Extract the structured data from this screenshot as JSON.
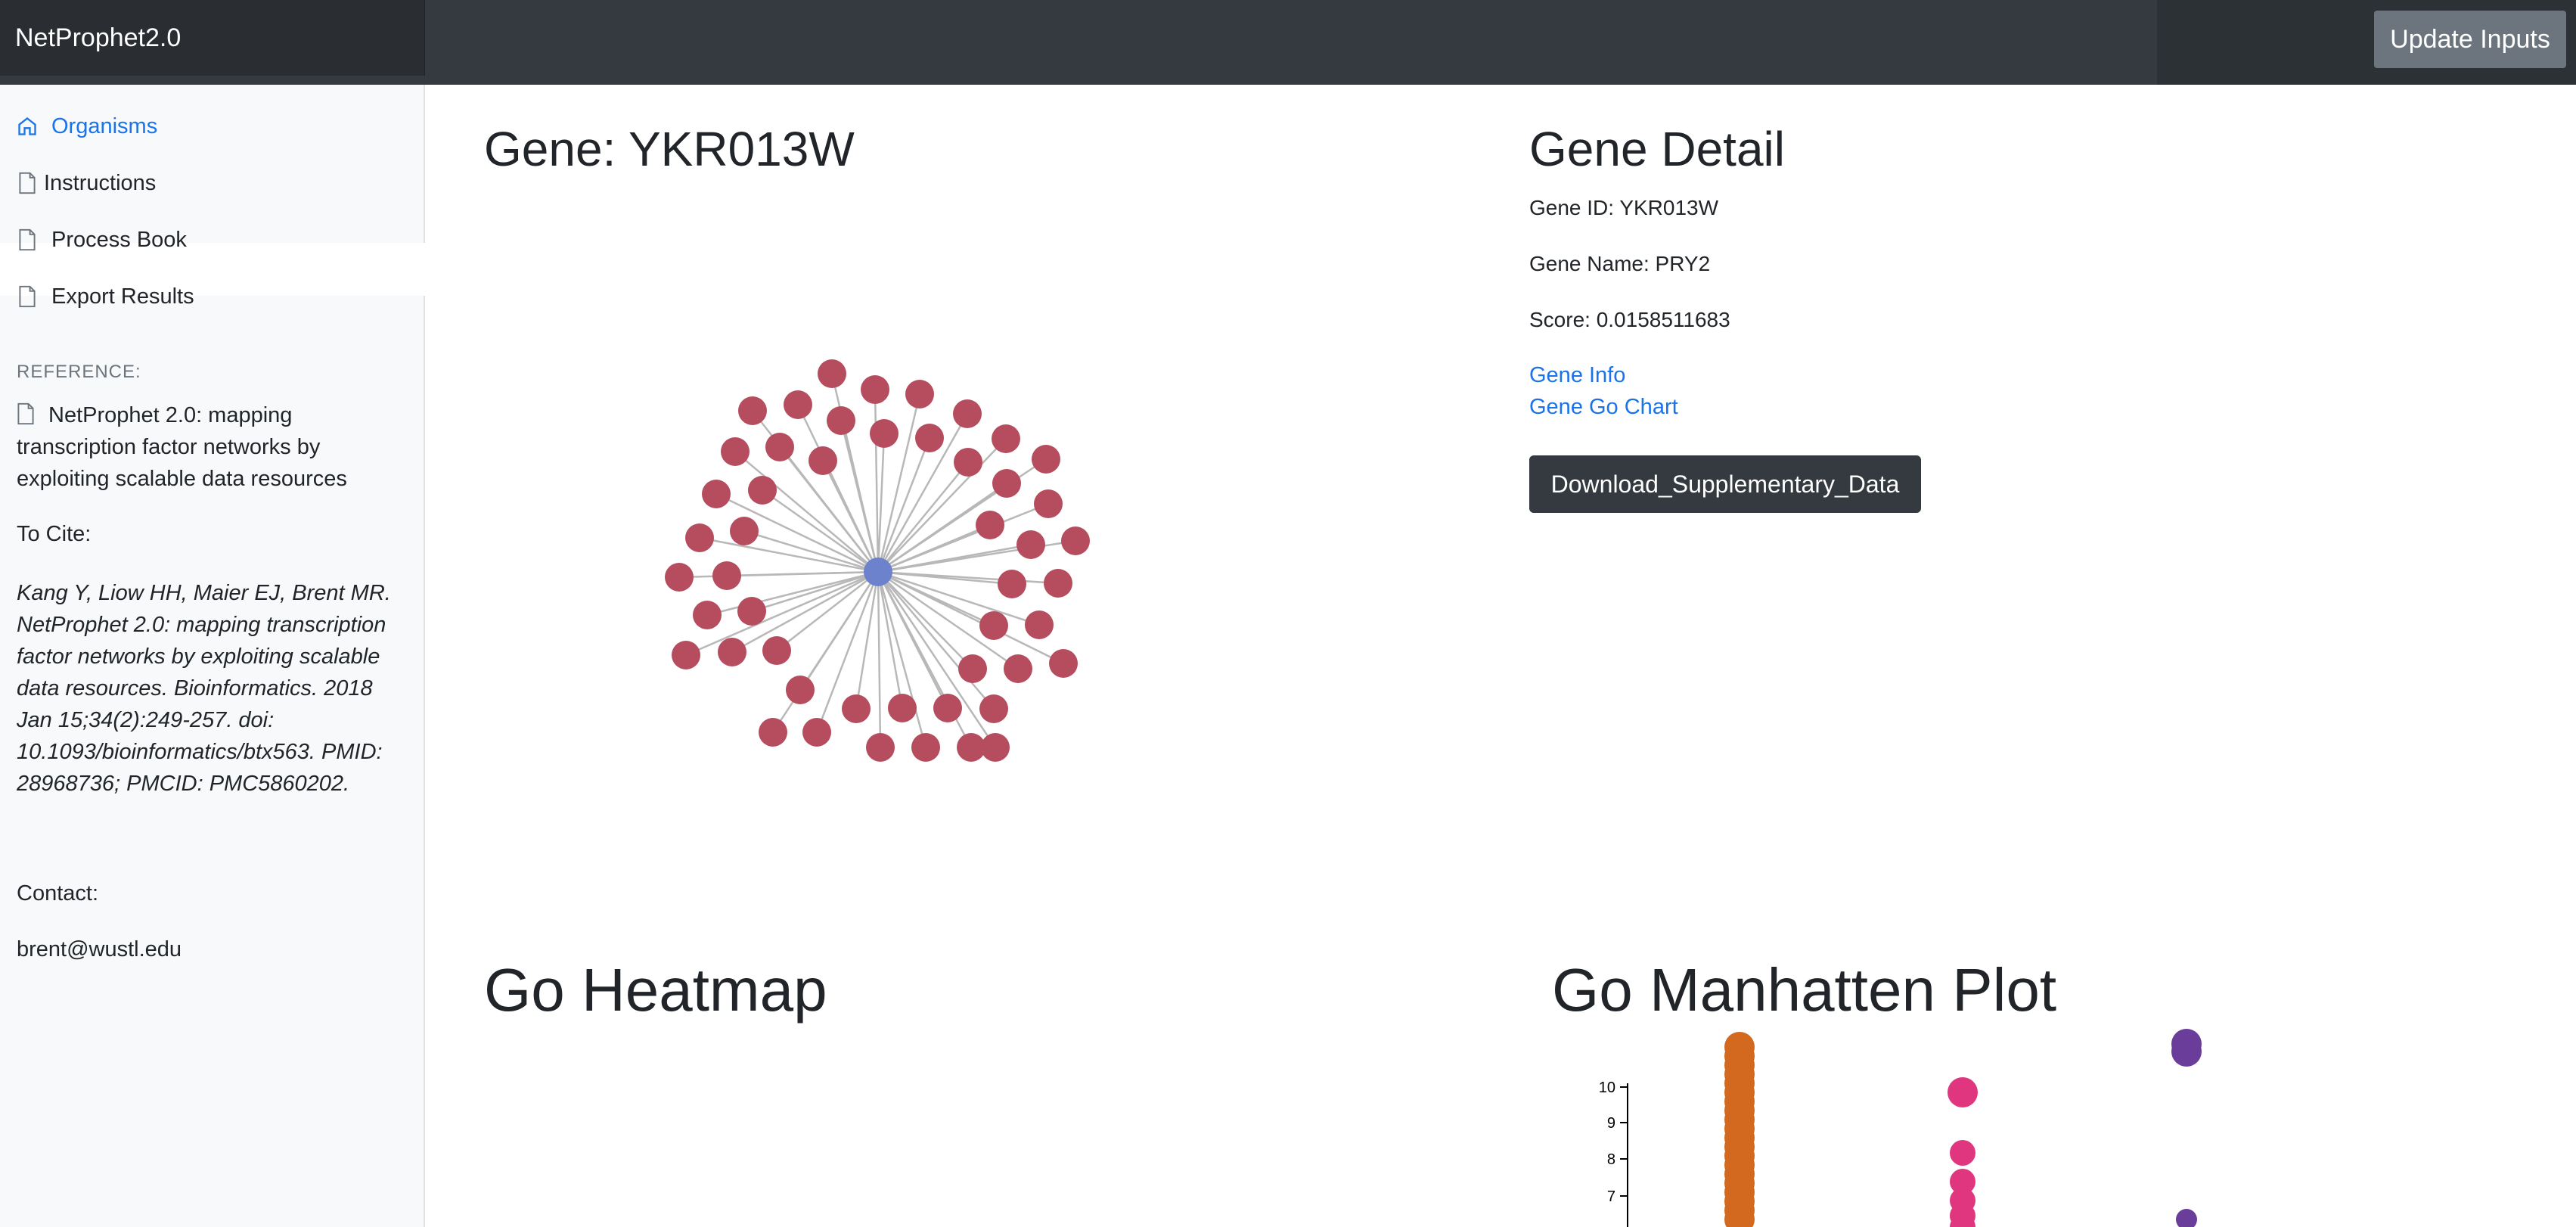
{
  "navbar": {
    "brand": "NetProphet2.0",
    "update_button": "Update Inputs"
  },
  "sidebar": {
    "items": [
      {
        "label": "Organisms",
        "icon": "home-icon",
        "active": true
      },
      {
        "label": "Instructions",
        "icon": "file-icon",
        "active": false
      },
      {
        "label": "Process Book",
        "icon": "file-icon",
        "active": false
      },
      {
        "label": "Export Results",
        "icon": "file-icon",
        "active": false
      }
    ],
    "reference_label": "REFERENCE:",
    "reference_text": "NetProphet 2.0: mapping transcription factor networks by exploiting scalable data resources",
    "cite_label": "To Cite:",
    "cite_text": "Kang Y, Liow HH, Maier EJ, Brent MR. NetProphet 2.0: mapping transcription factor networks by exploiting scalable data resources. Bioinformatics. 2018 Jan 15;34(2):249-257. doi: 10.1093/bioinformatics/btx563. PMID: 28968736; PMCID: PMC5860202.",
    "contact_label": "Contact:",
    "contact_email": "brent@wustl.edu"
  },
  "gene_panel": {
    "title": "Gene: YKR013W",
    "network": {
      "center_color": "#6c82cc",
      "node_color": "#b54d5f",
      "edge_color": "#b8b8b8"
    }
  },
  "gene_detail": {
    "title": "Gene Detail",
    "gene_id": "Gene ID: YKR013W",
    "gene_name": "Gene Name: PRY2",
    "score": "Score: 0.0158511683",
    "link_info": "Gene Info",
    "link_go_chart": "Gene Go Chart",
    "download_button": "Download_Supplementary_Data"
  },
  "heatmap": {
    "title": "Go Heatmap"
  },
  "manhattan": {
    "title": "Go Manhatten Plot",
    "y_ticks": [
      "10",
      "9",
      "8",
      "7"
    ],
    "colors": {
      "orange": "#d2691e",
      "pink": "#e0357f",
      "purple": "#6a3d9a"
    }
  }
}
